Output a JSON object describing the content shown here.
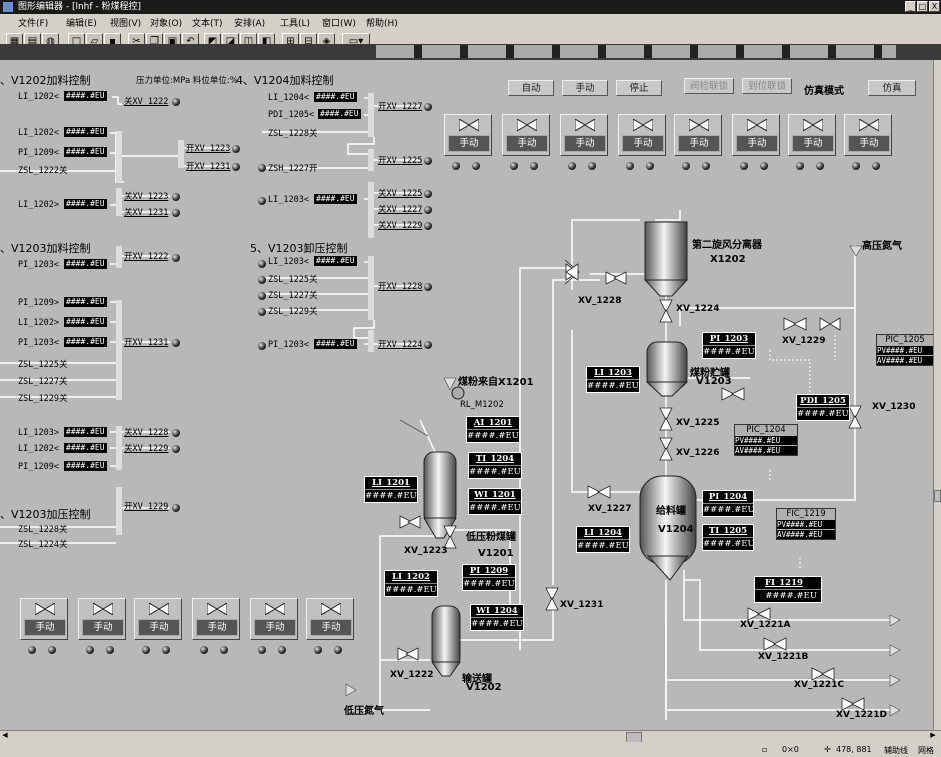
{
  "window": {
    "title": "图形编辑器 - [lnhf - 粉煤程控]",
    "buttons": [
      "_",
      "□",
      "X"
    ]
  },
  "menu": [
    "文件(F)",
    "编辑(E)",
    "视图(V)",
    "对象(O)",
    "文本(T)",
    "安排(A)",
    "工具(L)",
    "窗口(W)",
    "帮助(H)"
  ],
  "toolbar": {
    "icons": [
      "grid-icon",
      "grid2-icon",
      "paint-icon",
      "new-icon",
      "open-icon",
      "save-icon",
      "cut-icon",
      "copy-icon",
      "paste-icon",
      "undo-icon",
      "front-icon",
      "back-icon",
      "group-icon",
      "ungroup-icon",
      "align-icon",
      "align2-icon",
      "shape-icon",
      "rect-icon"
    ]
  },
  "left": {
    "sec1": {
      "title": "、V1202加料控制",
      "units": "压力单位:MPa  料位单位:%"
    },
    "sec1_rows": [
      {
        "label": "LI_1202<",
        "value": "####.#EU"
      },
      {
        "label": "LI_1202<",
        "value": "####.#EU"
      },
      {
        "label": "PI_1209<",
        "value": "####.#EU"
      },
      {
        "label": "ZSL_1222关",
        "value": ""
      },
      {
        "label": "LI_1202>",
        "value": "####.#EU"
      }
    ],
    "sec1_outputs": [
      "关XV_1222",
      "开XV_1223",
      "开XV_1231",
      "关XV_1223",
      "关XV_1231"
    ],
    "sec2": {
      "title": "、V1203加料控制"
    },
    "sec2_rows": [
      {
        "label": "PI_1203<",
        "value": "####.#EU"
      },
      {
        "label": "PI_1209>",
        "value": "####.#EU"
      },
      {
        "label": "LI_1202>",
        "value": "####.#EU"
      },
      {
        "label": "PI_1203<",
        "value": "####.#EU"
      },
      {
        "label": "ZSL_1225关",
        "value": ""
      },
      {
        "label": "ZSL_1227关",
        "value": ""
      },
      {
        "label": "ZSL_1229关",
        "value": ""
      },
      {
        "label": "LI_1203>",
        "value": "####.#EU"
      },
      {
        "label": "LI_1202<",
        "value": "####.#EU"
      },
      {
        "label": "PI_1209<",
        "value": "####.#EU"
      }
    ],
    "sec2_outputs": [
      "开XV_1222",
      "开XV_1231",
      "关XV_1228",
      "关XV_1229"
    ],
    "sec3": {
      "title": "、V1203加压控制"
    },
    "sec3_rows": [
      {
        "label": "ZSL_1228关"
      },
      {
        "label": "ZSL_1224关"
      }
    ],
    "sec3_outputs": [
      "开XV_1229"
    ]
  },
  "mid": {
    "sec4": {
      "title": "4、V1204加料控制"
    },
    "sec4_rows": [
      {
        "label": "LI_1204<",
        "value": "####.#EU"
      },
      {
        "label": "PDI_1205<",
        "value": "####.#EU"
      },
      {
        "label": "ZSL_1228关",
        "value": ""
      },
      {
        "label": "ZSH_1227开",
        "value": ""
      },
      {
        "label": "LI_1203<",
        "value": "####.#EU"
      }
    ],
    "sec4_outputs": [
      "开XV_1227",
      "开XV_1225",
      "关XV_1225",
      "关XV_1227",
      "关XV_1229"
    ],
    "sec5": {
      "title": "5、V1203卸压控制"
    },
    "sec5_rows": [
      {
        "label": "LI_1203<",
        "value": "####.#EU"
      },
      {
        "label": "ZSL_1225关",
        "value": ""
      },
      {
        "label": "ZSL_1227关",
        "value": ""
      },
      {
        "label": "ZSL_1229关",
        "value": ""
      },
      {
        "label": "PI_1203<",
        "value": "####.#EU"
      }
    ],
    "sec5_outputs": [
      "开XV_1228",
      "开XV_1224"
    ]
  },
  "controls": {
    "auto": "自动",
    "manual": "手动",
    "stop": "停止",
    "valve_interlock": "阀检联锁",
    "pos_interlock": "到位联锁",
    "sim_mode": "仿真模式",
    "sim": "仿真",
    "manual_box_label": "手动"
  },
  "process": {
    "sep_title": "第二旋风分离器",
    "sep_id": "X1202",
    "store_title": "煤粉贮罐",
    "store_id": "V1203",
    "feed_title": "给料罐",
    "feed_id": "V1204",
    "lp_title": "低压粉煤罐",
    "lp_id": "V1201",
    "tx_title": "输送罐",
    "tx_id": "V1202",
    "coal_in": "煤粉来自X1201",
    "motor": "RL_M1202",
    "hp_n2": "高压氮气",
    "lp_n2": "低压氮气",
    "valves": [
      "XV_1228",
      "XV_1224",
      "XV_1229",
      "XV_1230",
      "XV_1225",
      "XV_1226",
      "XV_1227",
      "XV_1223",
      "XV_1231",
      "XV_1222",
      "XV_1221A",
      "XV_1221B",
      "XV_1221C",
      "XV_1221D"
    ],
    "instruments": {
      "AI_1201": "####.#EU",
      "TI_1204": "####.#EU",
      "WI_1201": "####.#EU",
      "LI_1201": "####.#EU",
      "LI_1202": "####.#EU",
      "PI_1209": "####.#EU",
      "WI_1204": "####.#EU",
      "LI_1203": "####.#EU",
      "PI_1203": "####.#EU",
      "PDI_1205": "####.#EU",
      "PI_1204": "####.#EU",
      "TI_1205": "####.#EU",
      "LI_1204": "####.#EU",
      "FI_1219": "####.#EU"
    },
    "pic1205": {
      "tag": "PIC_1205",
      "pv": "PV####.#EU",
      "av": "AV####.#EU"
    },
    "pic1204": {
      "tag": "PIC_1204",
      "pv": "PV####.#EU",
      "av": "AV####.#EU"
    },
    "fic1219": {
      "tag": "FIC_1219",
      "pv": "PV####.#EU",
      "av": "AV####.#EU"
    }
  },
  "status": {
    "coords": "0×0",
    "pos": "478, 881",
    "f1": "辅助线",
    "f2": "网格"
  }
}
